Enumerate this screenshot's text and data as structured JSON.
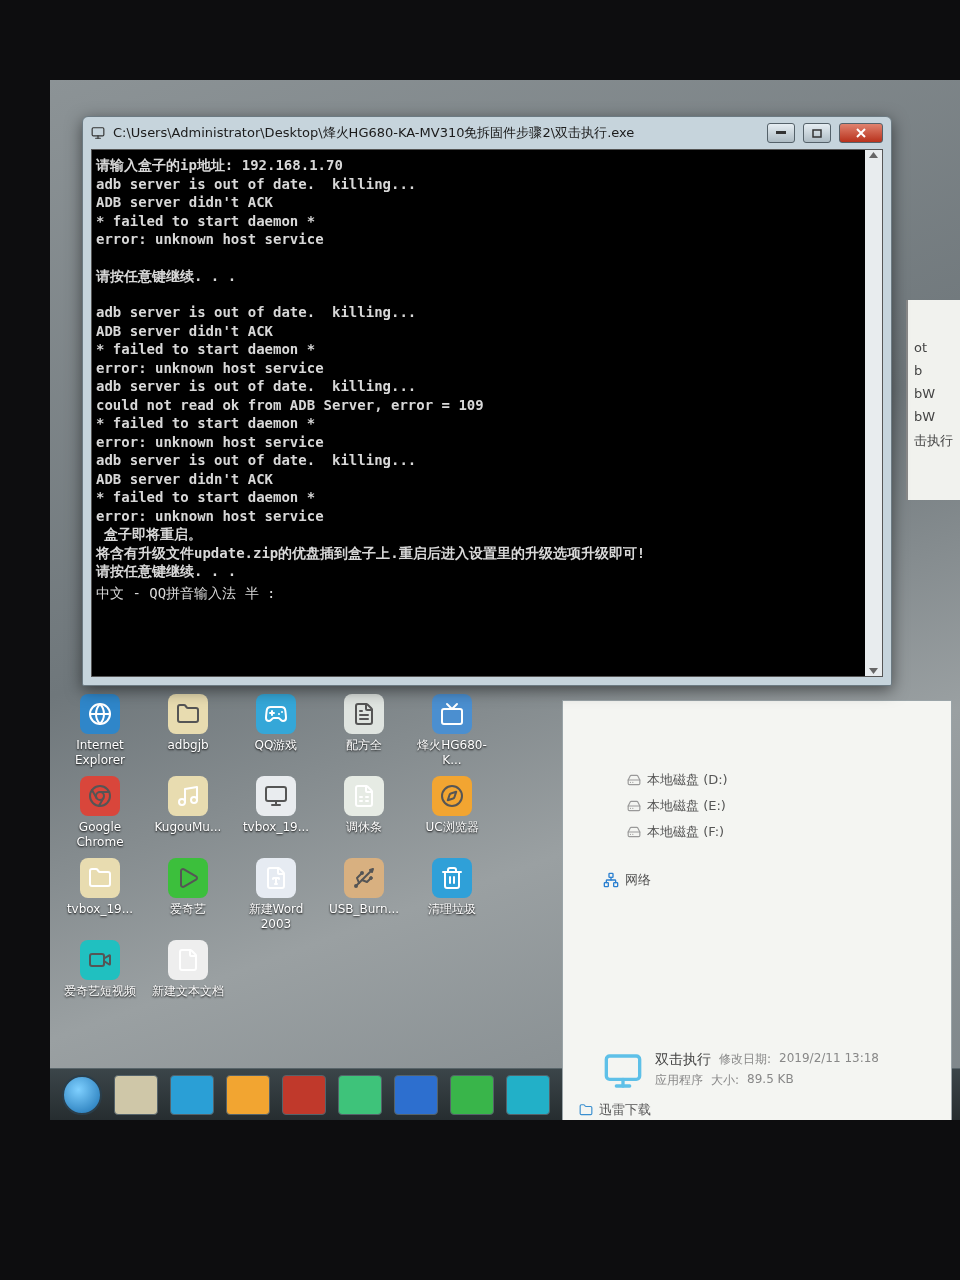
{
  "console_window": {
    "title": "C:\\Users\\Administrator\\Desktop\\烽火HG680-KA-MV310免拆固件步骤2\\双击执行.exe",
    "blocks": [
      [
        "请输入盒子的ip地址: 192.168.1.70",
        "adb server is out of date.  killing...",
        "ADB server didn't ACK",
        "* failed to start daemon *",
        "error: unknown host service"
      ],
      [
        "请按任意键继续. . ."
      ],
      [
        "adb server is out of date.  killing...",
        "ADB server didn't ACK",
        "* failed to start daemon *",
        "error: unknown host service",
        "adb server is out of date.  killing...",
        "could not read ok from ADB Server, error = 109",
        "* failed to start daemon *",
        "error: unknown host service",
        "adb server is out of date.  killing...",
        "ADB server didn't ACK",
        "* failed to start daemon *",
        "error: unknown host service",
        " 盒子即将重启。",
        "将含有升级文件update.zip的优盘插到盒子上.重启后进入设置里的升级选项升级即可!",
        "请按任意键继续. . ."
      ]
    ],
    "ime_status": "中文 - QQ拼音输入法 半 :"
  },
  "desktop_icons": [
    {
      "label": "Internet Explorer"
    },
    {
      "label": "adbgjb"
    },
    {
      "label": "QQ游戏"
    },
    {
      "label": "配方全"
    },
    {
      "label": "烽火HG680-K..."
    },
    {
      "label": "Google Chrome"
    },
    {
      "label": "KugouMu..."
    },
    {
      "label": "tvbox_19..."
    },
    {
      "label": "调休条"
    },
    {
      "label": "UC浏览器"
    },
    {
      "label": "tvbox_19..."
    },
    {
      "label": "爱奇艺"
    },
    {
      "label": "新建Word 2003"
    },
    {
      "label": "USB_Burn..."
    },
    {
      "label": "清理垃圾"
    },
    {
      "label": "爱奇艺短视频"
    },
    {
      "label": "新建文本文档"
    }
  ],
  "explorer_window": {
    "nav_items": [
      {
        "label": "本地磁盘 (D:)",
        "kind": "drive"
      },
      {
        "label": "本地磁盘 (E:)",
        "kind": "drive"
      },
      {
        "label": "本地磁盘 (F:)",
        "kind": "drive"
      },
      {
        "label": "网络",
        "kind": "network"
      }
    ],
    "details": {
      "name": "双击执行",
      "type": "应用程序",
      "modified_label": "修改日期:",
      "modified": "2019/2/11 13:18",
      "size_label": "大小:",
      "size": "89.5 KB"
    },
    "bottom_item": "迅雷下载"
  },
  "background_window": {
    "items": [
      "ot",
      "b",
      "bW",
      "bW",
      "击执行"
    ]
  }
}
